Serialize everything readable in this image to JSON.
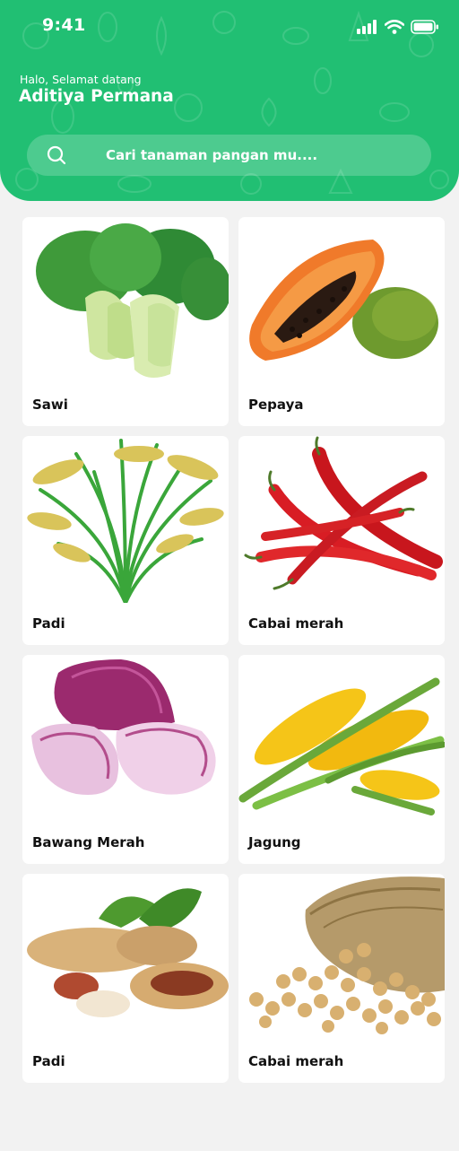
{
  "status_bar": {
    "time": "9:41"
  },
  "header": {
    "greeting": "Halo, Selamat datang",
    "user_name": "Aditiya Permana"
  },
  "search": {
    "placeholder": "Cari tanaman pangan mu....",
    "value": ""
  },
  "colors": {
    "brand_green": "#21bf73",
    "background": "#f2f2f2",
    "card": "#ffffff"
  },
  "products": [
    {
      "label": "Sawi",
      "icon": "bok-choy-image"
    },
    {
      "label": "Pepaya",
      "icon": "papaya-image"
    },
    {
      "label": "Padi",
      "icon": "rice-plant-image"
    },
    {
      "label": "Cabai merah",
      "icon": "red-chili-image"
    },
    {
      "label": "Bawang Merah",
      "icon": "red-onion-image"
    },
    {
      "label": "Jagung",
      "icon": "corn-image"
    },
    {
      "label": "Padi",
      "icon": "peanut-image"
    },
    {
      "label": "Cabai merah",
      "icon": "soybean-sack-image"
    }
  ]
}
